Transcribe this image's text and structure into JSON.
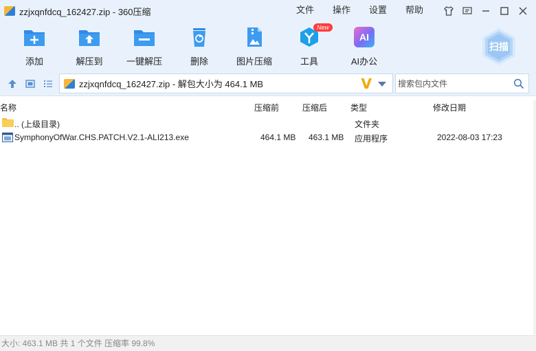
{
  "window": {
    "title": "zzjxqnfdcq_162427.zip - 360压缩",
    "menu": [
      "文件",
      "操作",
      "设置",
      "帮助"
    ]
  },
  "toolbar": {
    "add": "添加",
    "extract_to": "解压到",
    "one_click_extract": "一键解压",
    "delete": "删除",
    "image_compress": "图片压缩",
    "tools": "工具",
    "tools_badge": "New",
    "ai_office": "AI办公",
    "ai_icon_text": "AI",
    "scan": "扫描"
  },
  "address": {
    "path": "zzjxqnfdcq_162427.zip - 解包大小为 464.1 MB",
    "v_mark": "V",
    "search_placeholder": "搜索包内文件"
  },
  "columns": {
    "name": "名称",
    "before": "压缩前",
    "after": "压缩后",
    "type": "类型",
    "modified": "修改日期"
  },
  "rows": [
    {
      "name": ".. (上级目录)",
      "before": "",
      "after": "",
      "type": "文件夹",
      "modified": ""
    },
    {
      "name": "SymphonyOfWar.CHS.PATCH.V2.1-ALI213.exe",
      "before": "464.1 MB",
      "after": "463.1 MB",
      "type": "应用程序",
      "modified": "2022-08-03 17:23"
    }
  ],
  "status": "大小: 463.1 MB 共 1 个文件 压缩率 99.8%",
  "colors": {
    "chrome_bg": "#e9f2fc",
    "accent_blue": "#2f8be6",
    "v_mark": "#f2a900",
    "badge_red": "#ff3b3b"
  }
}
